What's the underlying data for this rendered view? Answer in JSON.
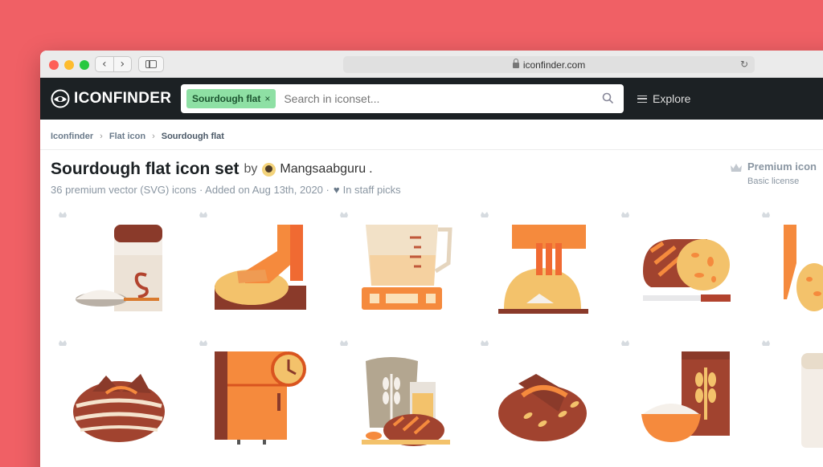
{
  "browser": {
    "url": "iconfinder.com"
  },
  "header": {
    "logo_text": "ICONFINDER",
    "search_tag": "Sourdough flat",
    "search_tag_close": "×",
    "search_placeholder": "Search in iconset...",
    "explore_label": "Explore"
  },
  "breadcrumb": [
    "Iconfinder",
    "Flat icon",
    "Sourdough flat"
  ],
  "iconset": {
    "title": "Sourdough flat icon set",
    "by": "by",
    "author": "Mangsaabguru",
    "author_suffix": ".",
    "meta": "36 premium vector (SVG) icons · Added on Aug 13th, 2020 ·",
    "staff_picks": "In staff picks",
    "premium_label": "Premium icon",
    "license": "Basic license"
  },
  "icons": [
    {
      "name": "starter-jar-icon"
    },
    {
      "name": "kneading-dough-icon"
    },
    {
      "name": "measuring-cup-scale-icon"
    },
    {
      "name": "hand-dough-bowl-icon"
    },
    {
      "name": "sliced-bread-knife-icon"
    },
    {
      "name": "hand-bread-icon"
    },
    {
      "name": "sourdough-loaf-icon"
    },
    {
      "name": "fridge-clock-icon"
    },
    {
      "name": "wheat-sack-bread-icon"
    },
    {
      "name": "scored-loaf-icon"
    },
    {
      "name": "flour-bag-bowl-icon"
    },
    {
      "name": "jar-icon"
    }
  ],
  "colors": {
    "background": "#f06065",
    "header": "#1c2124",
    "tag": "#8ee0a4",
    "crust": "#a1432f",
    "orange": "#f58a3d",
    "dough": "#f3c26b"
  }
}
